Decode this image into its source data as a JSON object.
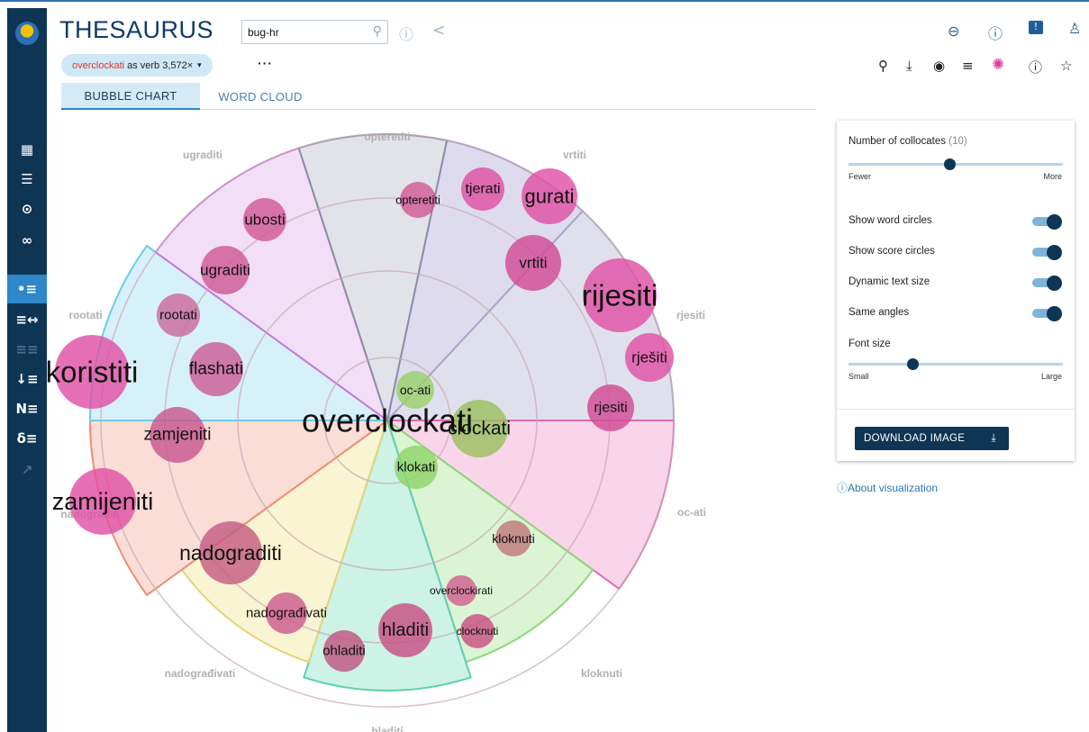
{
  "app": {
    "title": "THESAURUS"
  },
  "search": {
    "value": "bug-hr"
  },
  "query": {
    "word": "overclockati",
    "rest": "as verb 3,572×"
  },
  "tabs": [
    {
      "label": "BUBBLE CHART",
      "active": true
    },
    {
      "label": "WORD CLOUD",
      "active": false
    }
  ],
  "sidebar": {
    "items": [
      {
        "icon": "dashboard-icon",
        "glyph": "▦"
      },
      {
        "icon": "concordance-icon",
        "glyph": "☰"
      },
      {
        "icon": "word-sketch-icon",
        "glyph": "⊙"
      },
      {
        "icon": "sketch-difference-icon",
        "glyph": "∞"
      },
      {
        "icon": "thesaurus-icon",
        "glyph": "•≡",
        "active": true
      },
      {
        "icon": "parallel-concordance-icon",
        "glyph": "≡↔"
      },
      {
        "icon": "disabled-tool-icon",
        "glyph": "≡≡",
        "dim": true
      },
      {
        "icon": "wordlist-icon",
        "glyph": "↓≡"
      },
      {
        "icon": "ngrams-icon",
        "glyph": "N≡"
      },
      {
        "icon": "keywords-icon",
        "glyph": "δ≡"
      },
      {
        "icon": "trends-icon",
        "glyph": "↗",
        "dim": true
      }
    ]
  },
  "header_icons": [
    "link-icon",
    "help-icon",
    "feedback-icon",
    "user-icon"
  ],
  "toolbar_icons": [
    "zoom-icon",
    "download-icon",
    "view-icon",
    "filter-icon",
    "color-palette-icon",
    "info-icon",
    "star-icon"
  ],
  "chart_data": {
    "type": "bubble",
    "center_word": "overclockati",
    "sectors": [
      {
        "label": "vrtiti",
        "color": "#d0cce8",
        "stroke": "#a79cc9"
      },
      {
        "label": "rjesiti",
        "color": "#d3d3e4",
        "stroke": "#a9a7c9"
      },
      {
        "label": "oc-ati",
        "color": "#f6c3e0",
        "stroke": "#e06bb4"
      },
      {
        "label": "kloknuti",
        "color": "#ccefc0",
        "stroke": "#8fd67a"
      },
      {
        "label": "hladiti",
        "color": "#b8ecdc",
        "stroke": "#5fcfb4"
      },
      {
        "label": "nadograđivati",
        "color": "#f6efbd",
        "stroke": "#e3d57a"
      },
      {
        "label": "nadograditi",
        "color": "#f8d0c4",
        "stroke": "#ef8c75"
      },
      {
        "label": "rootati",
        "color": "#c4ebf8",
        "stroke": "#6fcbe8"
      },
      {
        "label": "ugraditi",
        "color": "#edd0f2",
        "stroke": "#c67ad8"
      },
      {
        "label": "opteretiti",
        "color": "#d6d6e0",
        "stroke": "#8d8da6"
      }
    ],
    "bubbles": [
      {
        "word": "overclockati"
      },
      {
        "word": "opteretiti"
      },
      {
        "word": "tjerati"
      },
      {
        "word": "gurati"
      },
      {
        "word": "vrtiti"
      },
      {
        "word": "rijesiti"
      },
      {
        "word": "rješiti"
      },
      {
        "word": "rjesiti"
      },
      {
        "word": "ubosti"
      },
      {
        "word": "ugraditi"
      },
      {
        "word": "rootati"
      },
      {
        "word": "koristiti"
      },
      {
        "word": "flashati"
      },
      {
        "word": "oc-ati"
      },
      {
        "word": "clockati"
      },
      {
        "word": "zamjeniti"
      },
      {
        "word": "klokati"
      },
      {
        "word": "zamijeniti"
      },
      {
        "word": "nadograditi"
      },
      {
        "word": "kloknuti"
      },
      {
        "word": "overclockirati"
      },
      {
        "word": "nadograđivati"
      },
      {
        "word": "hladiti"
      },
      {
        "word": "clocknuti"
      },
      {
        "word": "ohladiti"
      }
    ]
  },
  "settings": {
    "collocates_label": "Number of collocates",
    "collocates_value": "(10)",
    "collocates_level": 0.47,
    "fewer_label": "Fewer",
    "more_label": "More",
    "toggles": [
      {
        "label": "Show word circles",
        "on": true
      },
      {
        "label": "Show score circles",
        "on": true
      },
      {
        "label": "Dynamic text size",
        "on": true
      },
      {
        "label": "Same angles",
        "on": true
      }
    ],
    "font_size_label": "Font size",
    "font_size_level": 0.3,
    "small_label": "Small",
    "large_label": "Large",
    "download_label": "DOWNLOAD IMAGE"
  },
  "about_link": "ⓘAbout visualization"
}
